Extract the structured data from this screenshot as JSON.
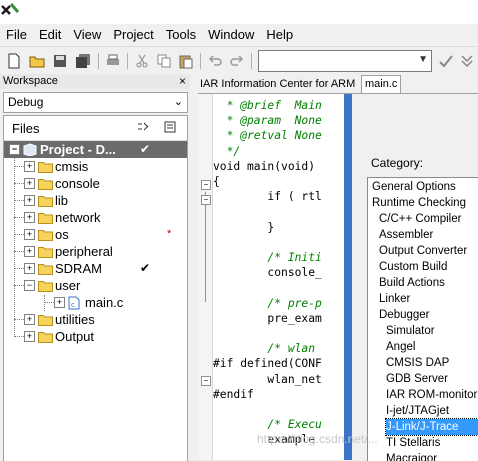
{
  "menu": [
    "File",
    "Edit",
    "View",
    "Project",
    "Tools",
    "Window",
    "Help"
  ],
  "toolbar": {
    "icons": [
      "new-file-icon",
      "open-folder-icon",
      "save-icon",
      "save-all-icon",
      "print-icon",
      "cut-icon",
      "copy-icon",
      "paste-icon",
      "undo-icon",
      "redo-icon",
      "find-check-icon",
      "find-down-icon"
    ]
  },
  "workspace": {
    "title": "Workspace",
    "close": "×",
    "config": "Debug",
    "files_header": "Files",
    "project": "Project - D...",
    "items": [
      {
        "name": "cmsis",
        "check": "",
        "star": ""
      },
      {
        "name": "console",
        "check": "",
        "star": ""
      },
      {
        "name": "lib",
        "check": "",
        "star": ""
      },
      {
        "name": "network",
        "check": "",
        "star": ""
      },
      {
        "name": "os",
        "check": "",
        "star": "*"
      },
      {
        "name": "peripheral",
        "check": "",
        "star": ""
      },
      {
        "name": "SDRAM",
        "check": "✔",
        "star": ""
      },
      {
        "name": "user",
        "check": "",
        "star": ""
      },
      {
        "name": "main.c",
        "check": "",
        "star": ""
      },
      {
        "name": "utilities",
        "check": "",
        "star": ""
      },
      {
        "name": "Output",
        "check": "",
        "star": ""
      }
    ],
    "project_check": "✔"
  },
  "tabs": [
    "IAR Information Center for ARM",
    "main.c"
  ],
  "code": [
    {
      "t": "cm",
      "text": "  * @brief  Main"
    },
    {
      "t": "cm",
      "text": "  * @param  None"
    },
    {
      "t": "cm",
      "text": "  * @retval None"
    },
    {
      "t": "cm",
      "text": "  */"
    },
    {
      "t": "n",
      "text": "void main(void)"
    },
    {
      "t": "n",
      "text": "{"
    },
    {
      "t": "n",
      "text": "        if ( rtl"
    },
    {
      "t": "n",
      "text": ""
    },
    {
      "t": "n",
      "text": "        }"
    },
    {
      "t": "n",
      "text": ""
    },
    {
      "t": "cm",
      "text": "        /* Initi"
    },
    {
      "t": "n",
      "text": "        console_"
    },
    {
      "t": "n",
      "text": ""
    },
    {
      "t": "cm",
      "text": "        /* pre-p"
    },
    {
      "t": "n",
      "text": "        pre_exam"
    },
    {
      "t": "n",
      "text": ""
    },
    {
      "t": "cm",
      "text": "        /* wlan "
    },
    {
      "t": "n",
      "text": "#if defined(CONF"
    },
    {
      "t": "n",
      "text": "        wlan_net"
    },
    {
      "t": "n",
      "text": "#endif"
    },
    {
      "t": "n",
      "text": ""
    },
    {
      "t": "cm",
      "text": "        /* Execu"
    },
    {
      "t": "n",
      "text": "        example"
    }
  ],
  "dialog": {
    "category_label": "Category:",
    "categories": [
      {
        "label": "General Options",
        "indent": 0
      },
      {
        "label": "Runtime Checking",
        "indent": 0
      },
      {
        "label": "C/C++ Compiler",
        "indent": 1
      },
      {
        "label": "Assembler",
        "indent": 1
      },
      {
        "label": "Output Converter",
        "indent": 1
      },
      {
        "label": "Custom Build",
        "indent": 1
      },
      {
        "label": "Build Actions",
        "indent": 1
      },
      {
        "label": "Linker",
        "indent": 1
      },
      {
        "label": "Debugger",
        "indent": 1
      },
      {
        "label": "Simulator",
        "indent": 2
      },
      {
        "label": "Angel",
        "indent": 2
      },
      {
        "label": "CMSIS DAP",
        "indent": 2
      },
      {
        "label": "GDB Server",
        "indent": 2
      },
      {
        "label": "IAR ROM-monitor",
        "indent": 2
      },
      {
        "label": "I-jet/JTAGjet",
        "indent": 2
      },
      {
        "label": "J-Link/J-Trace",
        "indent": 2
      },
      {
        "label": "TI Stellaris",
        "indent": 2
      },
      {
        "label": "Macraigor",
        "indent": 2
      }
    ],
    "selected": "J-Link/J-Trace",
    "accent": "#3399ff"
  },
  "watermark": "https://blog.csdn.net/..."
}
